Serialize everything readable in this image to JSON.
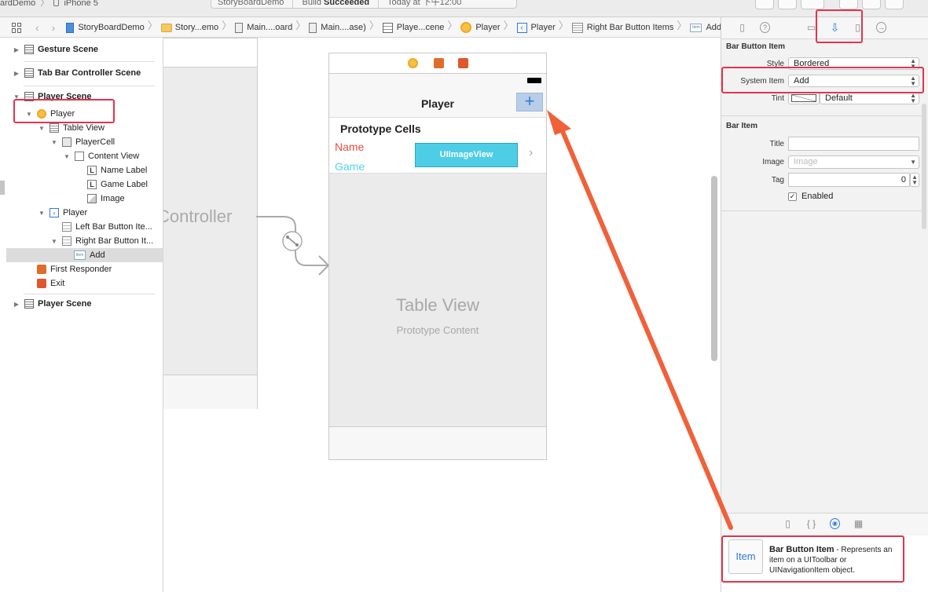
{
  "toolbar": {
    "scheme": "ardDemo",
    "device": "iPhone 5",
    "status_project": "StoryBoardDemo",
    "status_build_prefix": "Build",
    "status_build_result": "Succeeded",
    "status_time": "Today at 下午12:00"
  },
  "jumpbar": {
    "crumbs": [
      "StoryBoardDemo",
      "Story...emo",
      "Main....oard",
      "Main....ase)",
      "Playe...cene",
      "Player",
      "Player",
      "Right Bar Button Items",
      "Add"
    ]
  },
  "outline": {
    "items": [
      {
        "label": "Gesture Scene"
      },
      {
        "label": "Tab Bar Controller Scene"
      },
      {
        "label": "Player Scene"
      },
      {
        "label": "Player"
      },
      {
        "label": "Table View"
      },
      {
        "label": "PlayerCell"
      },
      {
        "label": "Content View"
      },
      {
        "label": "Name Label"
      },
      {
        "label": "Game Label"
      },
      {
        "label": "Image"
      },
      {
        "label": "Player"
      },
      {
        "label": "Left Bar Button Ite..."
      },
      {
        "label": "Right Bar Button It..."
      },
      {
        "label": "Add"
      },
      {
        "label": "First Responder"
      },
      {
        "label": "Exit"
      },
      {
        "label": "Player Scene"
      }
    ]
  },
  "canvas": {
    "prev_controller_title": "Controller",
    "nav_title": "Player",
    "add_glyph": "+",
    "prototype_header": "Prototype Cells",
    "cell_name": "Name",
    "cell_game": "Game",
    "image_view": "UIImageView",
    "disclosure": "›",
    "table_view_title": "Table View",
    "table_view_sub": "Prototype Content"
  },
  "inspector": {
    "section1_title": "Bar Button Item",
    "style_label": "Style",
    "style_value": "Bordered",
    "system_item_label": "System Item",
    "system_item_value": "Add",
    "tint_label": "Tint",
    "tint_value": "Default",
    "section2_title": "Bar Item",
    "title_label": "Title",
    "title_value": "",
    "image_label": "Image",
    "image_placeholder": "Image",
    "tag_label": "Tag",
    "tag_value": "0",
    "enabled_label": "Enabled",
    "enabled_checked": true
  },
  "library": {
    "thumb": "Item",
    "name": "Bar Button Item",
    "description": " - Represents an item on a UIToolbar or UINavigationItem object."
  },
  "colors": {
    "accent_blue": "#2f7ad6",
    "highlight_red": "#e2344b",
    "arrow_orange": "#f0613a",
    "image_view_cyan": "#4ecde6",
    "name_red": "#e74c3c",
    "game_cyan": "#4fd6ea"
  },
  "icons": [
    "grid-icon",
    "back-arrow-icon",
    "forward-arrow-icon",
    "folder-icon",
    "storyboard-file-icon",
    "scene-icon",
    "view-controller-icon",
    "navigation-item-icon",
    "bar-items-icon",
    "bar-button-icon",
    "attributes-inspector-icon",
    "file-inspector-icon",
    "quick-help-icon",
    "identity-inspector-icon",
    "size-inspector-icon",
    "connections-inspector-icon",
    "first-responder-icon",
    "exit-icon",
    "segue-icon",
    "battery-icon"
  ]
}
